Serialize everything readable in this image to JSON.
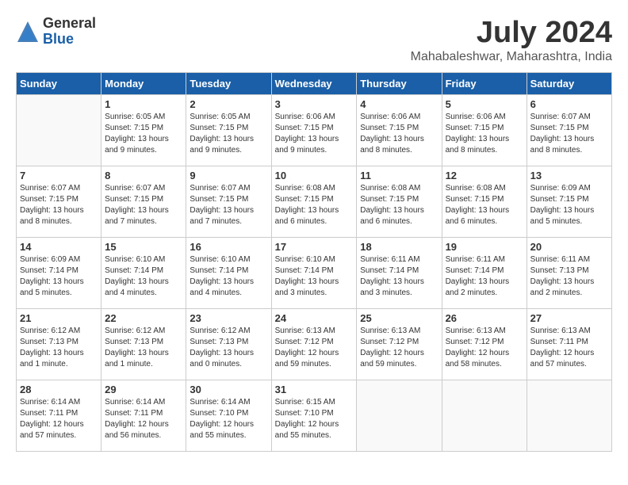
{
  "logo": {
    "general": "General",
    "blue": "Blue"
  },
  "title": "July 2024",
  "location": "Mahabaleshwar, Maharashtra, India",
  "days_of_week": [
    "Sunday",
    "Monday",
    "Tuesday",
    "Wednesday",
    "Thursday",
    "Friday",
    "Saturday"
  ],
  "weeks": [
    [
      {
        "day": "",
        "info": ""
      },
      {
        "day": "1",
        "info": "Sunrise: 6:05 AM\nSunset: 7:15 PM\nDaylight: 13 hours\nand 9 minutes."
      },
      {
        "day": "2",
        "info": "Sunrise: 6:05 AM\nSunset: 7:15 PM\nDaylight: 13 hours\nand 9 minutes."
      },
      {
        "day": "3",
        "info": "Sunrise: 6:06 AM\nSunset: 7:15 PM\nDaylight: 13 hours\nand 9 minutes."
      },
      {
        "day": "4",
        "info": "Sunrise: 6:06 AM\nSunset: 7:15 PM\nDaylight: 13 hours\nand 8 minutes."
      },
      {
        "day": "5",
        "info": "Sunrise: 6:06 AM\nSunset: 7:15 PM\nDaylight: 13 hours\nand 8 minutes."
      },
      {
        "day": "6",
        "info": "Sunrise: 6:07 AM\nSunset: 7:15 PM\nDaylight: 13 hours\nand 8 minutes."
      }
    ],
    [
      {
        "day": "7",
        "info": "Sunrise: 6:07 AM\nSunset: 7:15 PM\nDaylight: 13 hours\nand 8 minutes."
      },
      {
        "day": "8",
        "info": "Sunrise: 6:07 AM\nSunset: 7:15 PM\nDaylight: 13 hours\nand 7 minutes."
      },
      {
        "day": "9",
        "info": "Sunrise: 6:07 AM\nSunset: 7:15 PM\nDaylight: 13 hours\nand 7 minutes."
      },
      {
        "day": "10",
        "info": "Sunrise: 6:08 AM\nSunset: 7:15 PM\nDaylight: 13 hours\nand 6 minutes."
      },
      {
        "day": "11",
        "info": "Sunrise: 6:08 AM\nSunset: 7:15 PM\nDaylight: 13 hours\nand 6 minutes."
      },
      {
        "day": "12",
        "info": "Sunrise: 6:08 AM\nSunset: 7:15 PM\nDaylight: 13 hours\nand 6 minutes."
      },
      {
        "day": "13",
        "info": "Sunrise: 6:09 AM\nSunset: 7:15 PM\nDaylight: 13 hours\nand 5 minutes."
      }
    ],
    [
      {
        "day": "14",
        "info": "Sunrise: 6:09 AM\nSunset: 7:14 PM\nDaylight: 13 hours\nand 5 minutes."
      },
      {
        "day": "15",
        "info": "Sunrise: 6:10 AM\nSunset: 7:14 PM\nDaylight: 13 hours\nand 4 minutes."
      },
      {
        "day": "16",
        "info": "Sunrise: 6:10 AM\nSunset: 7:14 PM\nDaylight: 13 hours\nand 4 minutes."
      },
      {
        "day": "17",
        "info": "Sunrise: 6:10 AM\nSunset: 7:14 PM\nDaylight: 13 hours\nand 3 minutes."
      },
      {
        "day": "18",
        "info": "Sunrise: 6:11 AM\nSunset: 7:14 PM\nDaylight: 13 hours\nand 3 minutes."
      },
      {
        "day": "19",
        "info": "Sunrise: 6:11 AM\nSunset: 7:14 PM\nDaylight: 13 hours\nand 2 minutes."
      },
      {
        "day": "20",
        "info": "Sunrise: 6:11 AM\nSunset: 7:13 PM\nDaylight: 13 hours\nand 2 minutes."
      }
    ],
    [
      {
        "day": "21",
        "info": "Sunrise: 6:12 AM\nSunset: 7:13 PM\nDaylight: 13 hours\nand 1 minute."
      },
      {
        "day": "22",
        "info": "Sunrise: 6:12 AM\nSunset: 7:13 PM\nDaylight: 13 hours\nand 1 minute."
      },
      {
        "day": "23",
        "info": "Sunrise: 6:12 AM\nSunset: 7:13 PM\nDaylight: 13 hours\nand 0 minutes."
      },
      {
        "day": "24",
        "info": "Sunrise: 6:13 AM\nSunset: 7:12 PM\nDaylight: 12 hours\nand 59 minutes."
      },
      {
        "day": "25",
        "info": "Sunrise: 6:13 AM\nSunset: 7:12 PM\nDaylight: 12 hours\nand 59 minutes."
      },
      {
        "day": "26",
        "info": "Sunrise: 6:13 AM\nSunset: 7:12 PM\nDaylight: 12 hours\nand 58 minutes."
      },
      {
        "day": "27",
        "info": "Sunrise: 6:13 AM\nSunset: 7:11 PM\nDaylight: 12 hours\nand 57 minutes."
      }
    ],
    [
      {
        "day": "28",
        "info": "Sunrise: 6:14 AM\nSunset: 7:11 PM\nDaylight: 12 hours\nand 57 minutes."
      },
      {
        "day": "29",
        "info": "Sunrise: 6:14 AM\nSunset: 7:11 PM\nDaylight: 12 hours\nand 56 minutes."
      },
      {
        "day": "30",
        "info": "Sunrise: 6:14 AM\nSunset: 7:10 PM\nDaylight: 12 hours\nand 55 minutes."
      },
      {
        "day": "31",
        "info": "Sunrise: 6:15 AM\nSunset: 7:10 PM\nDaylight: 12 hours\nand 55 minutes."
      },
      {
        "day": "",
        "info": ""
      },
      {
        "day": "",
        "info": ""
      },
      {
        "day": "",
        "info": ""
      }
    ]
  ]
}
